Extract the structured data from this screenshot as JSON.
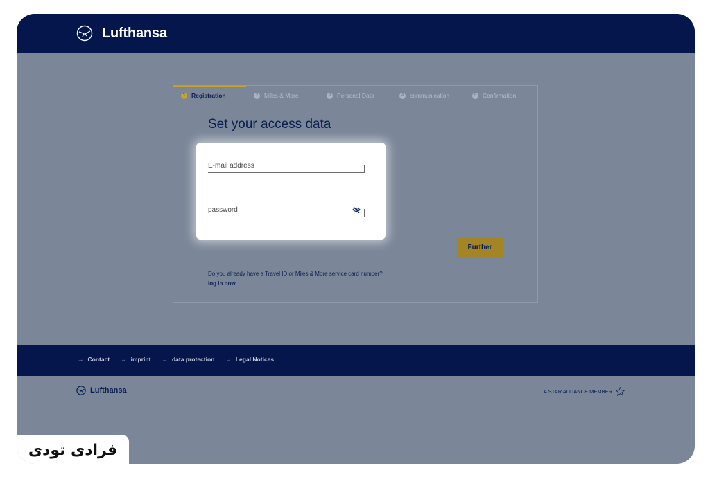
{
  "header": {
    "brand": "Lufthansa"
  },
  "steps": [
    {
      "num": "1",
      "label": "Registration",
      "active": true
    },
    {
      "num": "2",
      "label": "Miles & More",
      "active": false
    },
    {
      "num": "3",
      "label": "Personal Data",
      "active": false
    },
    {
      "num": "4",
      "label": "communication",
      "active": false
    },
    {
      "num": "5",
      "label": "Confirmation",
      "active": false
    }
  ],
  "form": {
    "title": "Set your access data",
    "email_placeholder": "E-mail address",
    "password_placeholder": "password",
    "further_label": "Further",
    "travel_id_question": "Do you already have a Travel ID or Miles & More service card number?",
    "login_link": "log in now"
  },
  "footer": {
    "links": [
      "Contact",
      "imprint",
      "data protection",
      "Legal Notices"
    ],
    "brand": "Lufthansa",
    "star_alliance": "A STAR ALLIANCE MEMBER"
  },
  "watermark": {
    "text": "فرادی تودی"
  },
  "colors": {
    "navy": "#05164d",
    "overlay": "#7b8799",
    "gold": "#a48526"
  }
}
